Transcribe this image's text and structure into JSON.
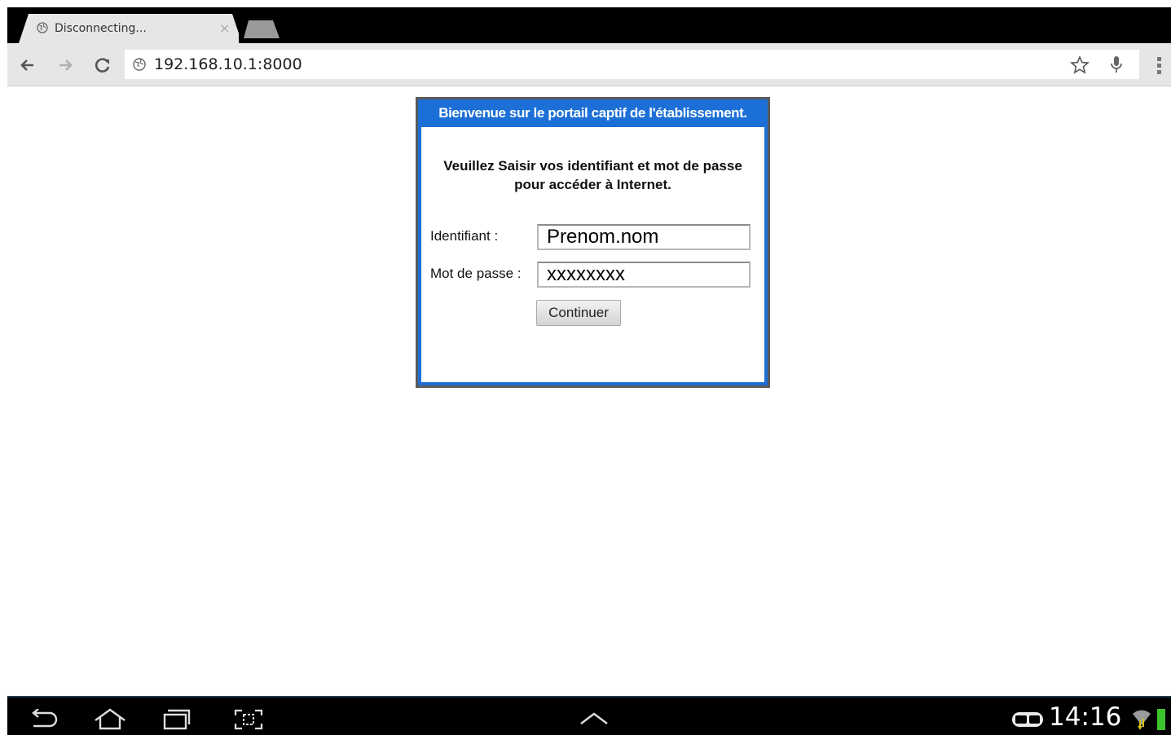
{
  "browser": {
    "tab": {
      "title": "Disconnecting...",
      "close_glyph": "×"
    },
    "address": "192.168.10.1:8000"
  },
  "portal": {
    "header": "Bienvenue sur le portail captif de l'établissement.",
    "instructions_line1": "Veuillez Saisir vos identifiant et mot de passe",
    "instructions_line2": "pour accéder à Internet.",
    "username_label": "Identifiant :",
    "username_value": "Prenom.nom",
    "password_label": "Mot de passe :",
    "password_value": "xxxxxxxx",
    "submit_label": "Continuer"
  },
  "system_bar": {
    "time": "14:16",
    "icons": [
      "back-icon",
      "home-icon",
      "recent-apps-icon",
      "screenshot-icon",
      "expand-up-icon",
      "wifi-badge-icon",
      "wifi-signal-icon",
      "battery-icon"
    ]
  },
  "colors": {
    "portal_accent": "#1c6fd6",
    "tab_background": "#e6e6e6",
    "chrome_bar": "#000000"
  }
}
